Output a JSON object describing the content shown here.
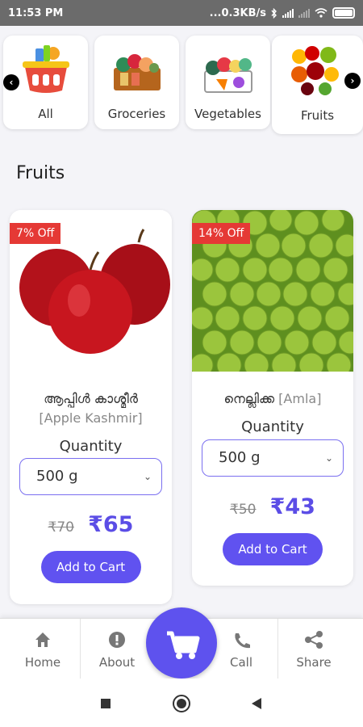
{
  "status_bar": {
    "time": "11:53 PM",
    "network_speed": "...0.3KB/s"
  },
  "categories": [
    {
      "label": "All",
      "icon": "basket-icon"
    },
    {
      "label": "Groceries",
      "icon": "groceries-icon"
    },
    {
      "label": "Vegetables",
      "icon": "vegetables-icon"
    },
    {
      "label": "Fruits",
      "icon": "fruits-icon"
    }
  ],
  "section": {
    "title": "Fruits"
  },
  "products": [
    {
      "discount": "7% Off",
      "name_local": "ആപ്പിൾ കാശ്മീർ",
      "name_en": "[Apple Kashmir]",
      "quantity_label": "Quantity",
      "selected_quantity": "500 g",
      "old_price": "₹70",
      "new_price": "₹65",
      "cart_label": "Add to Cart"
    },
    {
      "discount": "14% Off",
      "name_local": "നെല്ലിക്ക",
      "name_en": "[Amla]",
      "quantity_label": "Quantity",
      "selected_quantity": "500 g",
      "old_price": "₹50",
      "new_price": "₹43",
      "cart_label": "Add to Cart"
    }
  ],
  "bottom_nav": {
    "home": "Home",
    "about": "About",
    "call": "Call",
    "share": "Share"
  },
  "colors": {
    "accent": "#6052f0",
    "badge": "#e53935"
  }
}
